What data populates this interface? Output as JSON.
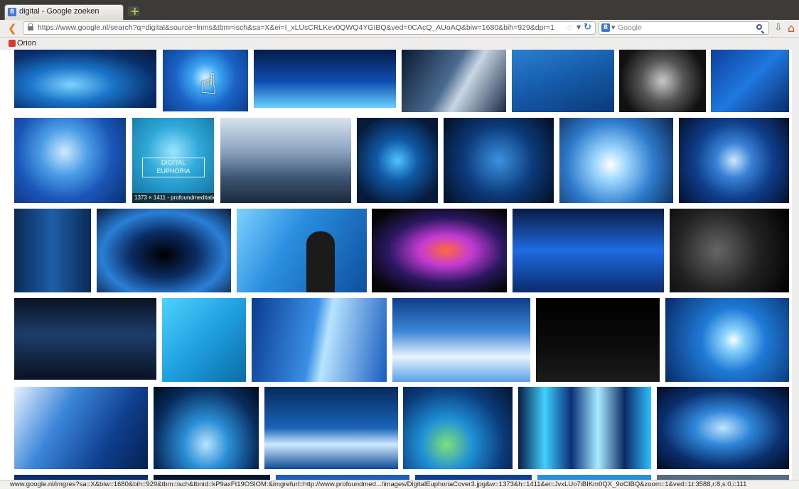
{
  "browser": {
    "tab_title": "digital - Google zoeken",
    "url": "https://www.google.nl/search?q=digital&source=lnms&tbm=isch&sa=X&ei=I_xLUsCRLKev0QWQ4YGIBQ&ved=0CAcQ_AUoAQ&biw=1680&bih=929&dpr=1",
    "search_placeholder": "Google",
    "bookmark_label": "Orion"
  },
  "results": {
    "hover_caption": "1373 × 1411 - profoundmeditatio..."
  },
  "status": {
    "text": "www.google.nl/imgres?sa=X&biw=1680&bih=929&tbm=isch&tbnid=kP9axFt19OSlOM:&imgrefurl=http://www.profoundmed.../images/DigitalEuphoriaCover3.jpg&w=1373&h=1411&ei=JvxLUo7iBIKm0QX_9oCIBQ&zoom=1&ved=1t:3588,r:8,s:0,i:111"
  },
  "colors": {
    "accent_blue": "#1f6fd1",
    "deep_blue": "#06235a",
    "cyan": "#36c6ff"
  }
}
